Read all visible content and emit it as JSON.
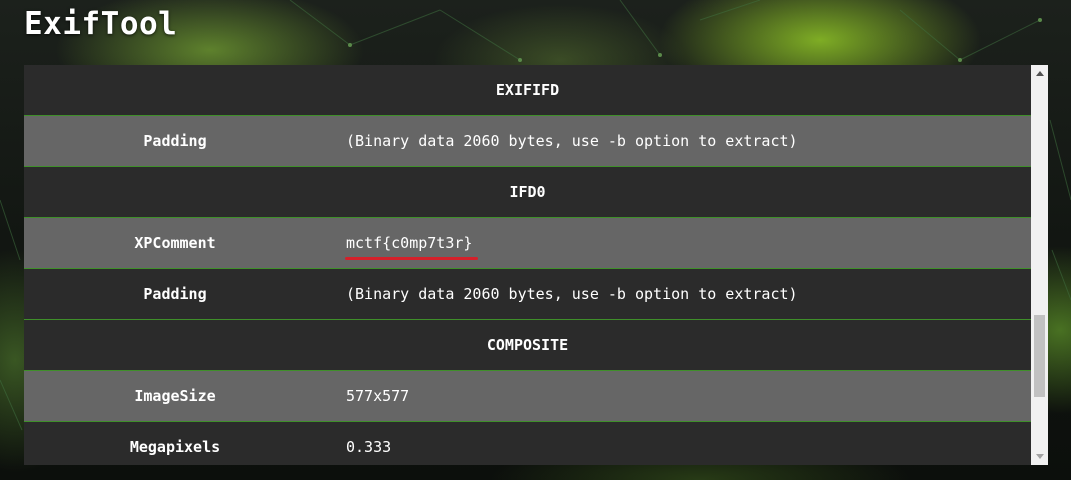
{
  "app": {
    "title": "ExifTool"
  },
  "table": {
    "rows": [
      {
        "type": "section",
        "label": "EXIFIFD"
      },
      {
        "type": "entry",
        "key": "Padding",
        "value": "(Binary data 2060 bytes, use -b option to extract)"
      },
      {
        "type": "section",
        "label": "IFD0"
      },
      {
        "type": "entry",
        "key": "XPComment",
        "value": "mctf{c0mp7t3r}",
        "highlighted": true
      },
      {
        "type": "entry",
        "key": "Padding",
        "value": "(Binary data 2060 bytes, use -b option to extract)"
      },
      {
        "type": "section",
        "label": "COMPOSITE"
      },
      {
        "type": "entry",
        "key": "ImageSize",
        "value": "577x577"
      },
      {
        "type": "entry",
        "key": "Megapixels",
        "value": "0.333"
      }
    ]
  },
  "scrollbar": {
    "position_fraction": 0.82,
    "up_icon": "arrow-up-icon",
    "down_icon": "arrow-down-icon"
  },
  "colors": {
    "row_dark": "#2b2b2b",
    "row_light": "#666666",
    "row_border": "#3f8f2a",
    "highlight_underline": "#d4202a",
    "text": "#ffffff"
  }
}
